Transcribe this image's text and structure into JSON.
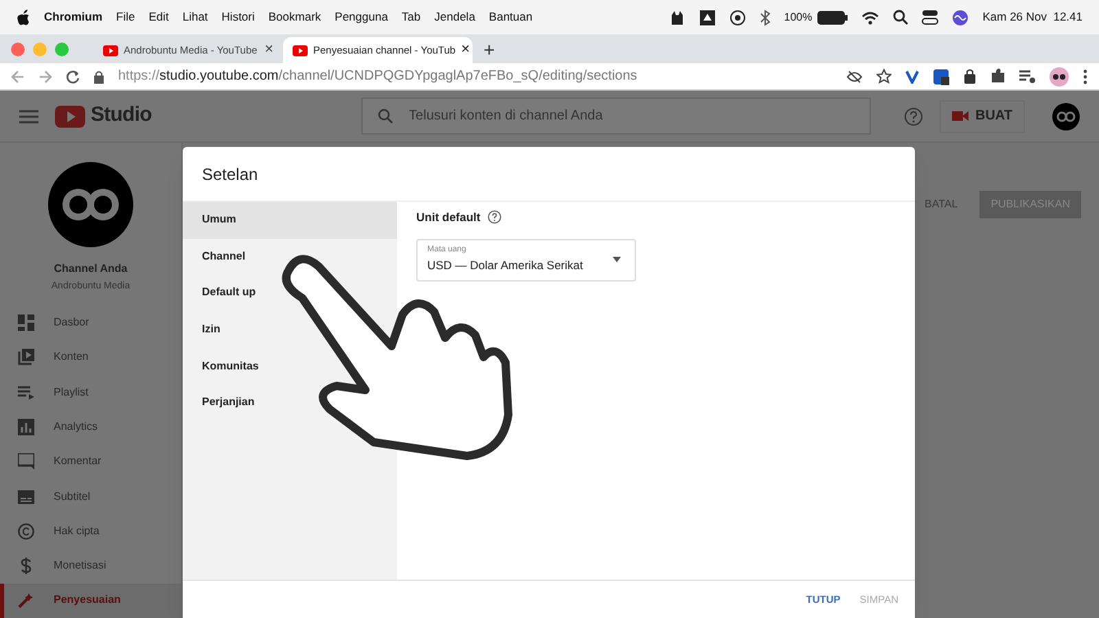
{
  "menubar": {
    "app": "Chromium",
    "menus": [
      "File",
      "Edit",
      "Lihat",
      "Histori",
      "Bookmark",
      "Pengguna",
      "Tab",
      "Jendela",
      "Bantuan"
    ],
    "battery": "100%",
    "clock": "Kam 26 Nov  12.41"
  },
  "tabs": [
    {
      "label": "Androbuntu Media - YouTube",
      "close": "×",
      "selected": false
    },
    {
      "label": "Penyesuaian channel - YouTub",
      "close": "×",
      "selected": true
    }
  ],
  "new_tab": "+",
  "address_bar": {
    "scheme": "https://",
    "host": "studio.youtube.com",
    "path": "/channel/UCNDPQGDYpgaglAp7eFBo_sQ/editing/sections"
  },
  "studio_header": {
    "logo": "Studio",
    "search": {
      "placeholder": "Telusuri konten di channel Anda"
    },
    "create_button": "BUAT"
  },
  "sidebar": {
    "channel_title": "Channel Anda",
    "channel_name": "Androbuntu Media",
    "items": [
      {
        "label": "Dasbor",
        "selected": false
      },
      {
        "label": "Konten",
        "selected": false
      },
      {
        "label": "Playlist",
        "selected": false
      },
      {
        "label": "Analytics",
        "selected": false
      },
      {
        "label": "Komentar",
        "selected": false
      },
      {
        "label": "Subtitel",
        "selected": false
      },
      {
        "label": "Hak cipta",
        "selected": false
      },
      {
        "label": "Monetisasi",
        "selected": false
      },
      {
        "label": "Penyesuaian",
        "selected": true
      }
    ]
  },
  "page_actions": [
    "BATAL",
    "PUBLIKASIKAN"
  ],
  "dialog": {
    "title": "Setelan",
    "nav": [
      {
        "label": "Umum",
        "selected": true
      },
      {
        "label": "Channel",
        "selected": false
      },
      {
        "label": "Default up",
        "selected": false
      },
      {
        "label": "Izin",
        "selected": false
      },
      {
        "label": "Komunitas",
        "selected": false
      },
      {
        "label": "Perjanjian",
        "selected": false
      }
    ],
    "section_title": "Unit default",
    "currency": {
      "label": "Mata uang",
      "value": "USD — Dolar Amerika Serikat"
    },
    "buttons": [
      {
        "label": "TUTUP",
        "disabled": false
      },
      {
        "label": "SIMPAN",
        "disabled": true
      }
    ]
  }
}
